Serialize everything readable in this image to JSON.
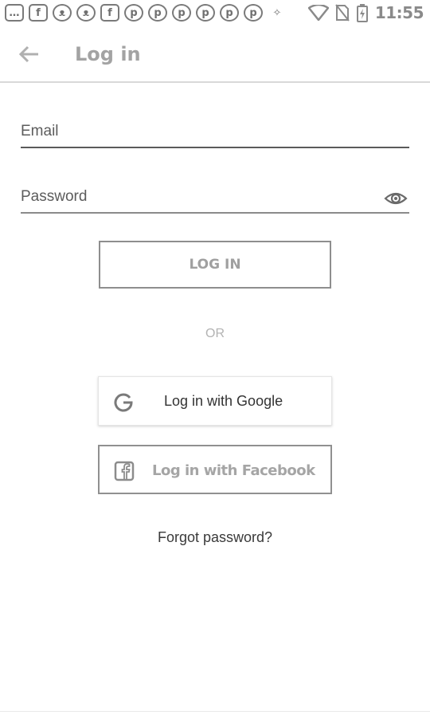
{
  "status_bar": {
    "left_icons": [
      "message-icon",
      "facebook-icon",
      "cat-icon",
      "cat-icon",
      "facebook-icon",
      "pinterest-icon",
      "pinterest-icon",
      "pinterest-icon",
      "pinterest-icon",
      "pinterest-icon",
      "pinterest-icon",
      "puzzle-icon"
    ],
    "time": "11:55"
  },
  "app_bar": {
    "title": "Log in",
    "back_icon": "arrow-left-icon"
  },
  "form": {
    "email_placeholder": "Email",
    "email_value": "",
    "password_placeholder": "Password",
    "password_value": "",
    "eye_icon": "eye-icon",
    "login_label": "LOG IN"
  },
  "divider_text": "OR",
  "social": {
    "google_label": "Log in with Google",
    "facebook_label": "Log in with Facebook"
  },
  "forgot_label": "Forgot password?"
}
